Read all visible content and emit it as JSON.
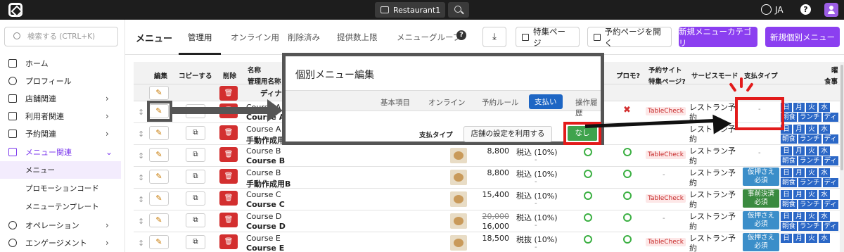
{
  "topbar": {
    "restaurant": "Restaurant1",
    "language": "JA",
    "help": "?"
  },
  "sidebar": {
    "search_placeholder": "検索する (CTRL+K)",
    "items": [
      {
        "label": "ホーム",
        "icon": "home-icon"
      },
      {
        "label": "プロフィール",
        "icon": "person-icon"
      },
      {
        "label": "店舗関連",
        "icon": "store-icon"
      },
      {
        "label": "利用者関連",
        "icon": "users-icon"
      },
      {
        "label": "予約関連",
        "icon": "calendar-icon"
      },
      {
        "label": "メニュー関連",
        "icon": "menu-book-icon"
      },
      {
        "label": "オペレーション",
        "icon": "gear-icon"
      },
      {
        "label": "エンゲージメント",
        "icon": "chat-icon"
      }
    ],
    "sub_items": [
      "メニュー",
      "プロモーションコード",
      "メニューテンプレート"
    ]
  },
  "header": {
    "title": "メニュー",
    "tabs": [
      "管理用",
      "オンライン用",
      "削除済み",
      "提供数上限",
      "メニューグループ"
    ],
    "help": "?",
    "buttons": {
      "feature": "特集ページ",
      "open_reserve": "予約ページを開く",
      "new_category": "新規メニューカテゴリ",
      "new_item": "新規個別メニュー"
    }
  },
  "table": {
    "headers": {
      "edit": "編集",
      "copy": "コピーする",
      "delete": "削除",
      "name": "名称",
      "admin_name": "管理用名称",
      "promo": "プロモ?",
      "reserve_site": "予約サイト",
      "feature_page": "特集ページ?",
      "service_mode": "サービスモード",
      "pay_type": "支払タイプ",
      "days_label": "曜",
      "meals_label": "食事"
    },
    "filter_text": "ディナー",
    "day_labels": [
      "日",
      "月",
      "火",
      "水"
    ],
    "meal_labels": [
      "朝食",
      "ランチ",
      "ディ"
    ],
    "rows": [
      {
        "name": "Course A",
        "admin": "Course A",
        "price": "",
        "tax": "",
        "tax_sub": "",
        "promo": "x",
        "tablecheck": "TableCheck",
        "mode1": "レストラン予",
        "mode2": "約",
        "pay": "-",
        "paytag": ""
      },
      {
        "name": "Course A",
        "admin": "手動作成用A",
        "price": "",
        "tax": "",
        "tax_sub": "",
        "promo": "",
        "tablecheck": "",
        "mode1": "レストラン予",
        "mode2": "約",
        "pay": "",
        "paytag": ""
      },
      {
        "name": "Course B",
        "admin": "Course B",
        "price": "8,800",
        "tax": "税込 (10%)",
        "tax_sub": "-",
        "promo": "o",
        "tablecheck": "TableCheck",
        "mode1": "レストラン予",
        "mode2": "約",
        "pay": "-",
        "paytag": ""
      },
      {
        "name": "Course B",
        "admin": "手動作成用B",
        "price": "8,800",
        "tax": "税込 (10%)",
        "tax_sub": "-",
        "promo": "o",
        "tablecheck": "-",
        "mode1": "レストラン予",
        "mode2": "約",
        "pay": "",
        "paytag": "仮押さえ\n必須"
      },
      {
        "name": "Course C",
        "admin": "Course C",
        "price": "15,400",
        "tax": "税込 (10%)",
        "tax_sub": "-",
        "promo": "o",
        "tablecheck": "TableCheck",
        "mode1": "レストラン予",
        "mode2": "約",
        "pay": "",
        "paytag": "事前決済\n必須"
      },
      {
        "name": "Course D",
        "admin": "Course D",
        "price": "20,000",
        "price2": "16,000",
        "tax": "税込 (10%)",
        "tax_sub": "-",
        "promo": "o",
        "tablecheck": "-",
        "mode1": "レストラン予",
        "mode2": "約",
        "pay": "",
        "paytag": "仮押さえ\n必須"
      },
      {
        "name": "Course E",
        "admin": "Course E",
        "price": "18,500",
        "tax": "税抜 (10%)",
        "tax_sub": "-",
        "promo": "o",
        "tablecheck": "TableCheck",
        "mode1": "レストラン予",
        "mode2": "約",
        "pay": "",
        "paytag": "仮押さえ\n必須"
      }
    ]
  },
  "modal": {
    "title": "個別メニュー編集",
    "tabs": [
      "基本項目",
      "オンライン",
      "予約ルール",
      "支払い",
      "操作履歴"
    ],
    "pay_label": "支払タイプ",
    "store_default": "店舗の設定を利用する",
    "none": "なし"
  },
  "colors": {
    "accent": "#8b3ff0",
    "highlight_red": "#e21b1b",
    "pay_tag_blue": "#3b8ec9",
    "pay_tag_green": "#3a8a3f",
    "day_blue": "#2b67c6"
  }
}
